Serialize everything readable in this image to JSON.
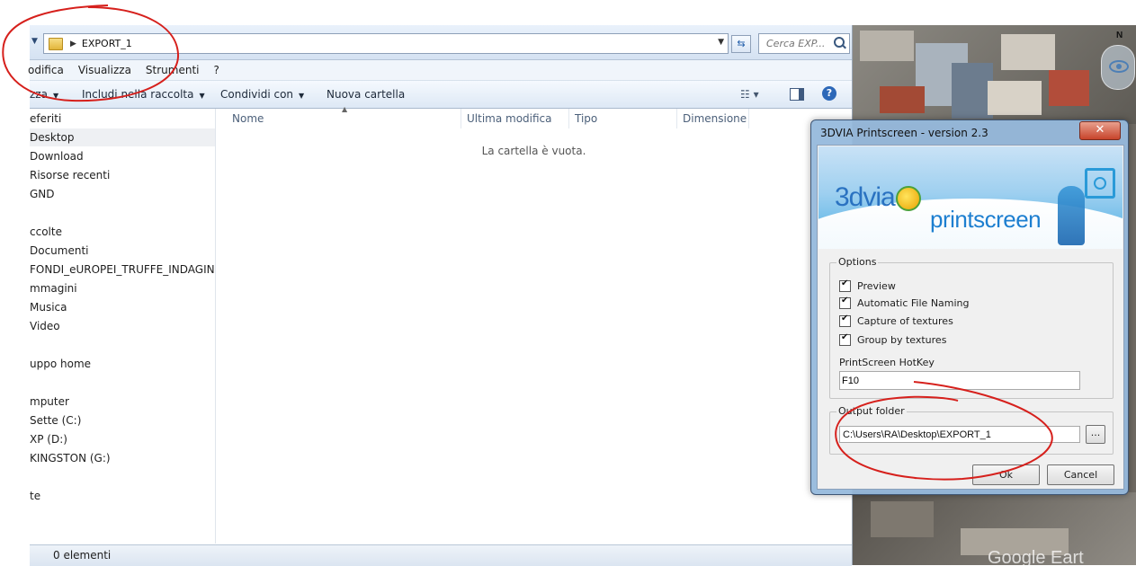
{
  "explorer": {
    "address": {
      "path": "EXPORT_1"
    },
    "search": {
      "placeholder": "Cerca EXP..."
    },
    "menu": [
      "odifica",
      "Visualizza",
      "Strumenti",
      "?"
    ],
    "commands": {
      "organize": "zza",
      "include": "Includi nella raccolta",
      "share": "Condividi con",
      "new_folder": "Nuova cartella"
    },
    "nav_items": [
      {
        "label": "eferiti",
        "selected": false
      },
      {
        "label": "Desktop",
        "selected": true
      },
      {
        "label": "Download",
        "selected": false
      },
      {
        "label": "Risorse recenti",
        "selected": false
      },
      {
        "label": "GND",
        "selected": false
      },
      {
        "label": "ccolte",
        "selected": false
      },
      {
        "label": "Documenti",
        "selected": false
      },
      {
        "label": "FONDI_eUROPEI_TRUFFE_INDAGINI_PER",
        "selected": false
      },
      {
        "label": "mmagini",
        "selected": false
      },
      {
        "label": "Musica",
        "selected": false
      },
      {
        "label": "Video",
        "selected": false
      },
      {
        "label": "uppo home",
        "selected": false
      },
      {
        "label": "mputer",
        "selected": false
      },
      {
        "label": "Sette (C:)",
        "selected": false
      },
      {
        "label": "XP (D:)",
        "selected": false
      },
      {
        "label": "KINGSTON (G:)",
        "selected": false
      },
      {
        "label": "te",
        "selected": false
      }
    ],
    "columns": [
      "Nome",
      "Ultima modifica",
      "Tipo",
      "Dimensione"
    ],
    "empty_message": "La cartella è vuota.",
    "status": "0 elementi"
  },
  "map": {
    "compass": "N",
    "watermark": "Google Eart"
  },
  "dialog": {
    "title": "3DVIA Printscreen - version 2.3",
    "close_label": "✕",
    "banner": {
      "brand": "3dvia",
      "product": "printscreen"
    },
    "options_title": "Options",
    "options": [
      {
        "label": "Preview",
        "checked": true
      },
      {
        "label": "Automatic File Naming",
        "checked": true
      },
      {
        "label": "Capture of textures",
        "checked": true
      },
      {
        "label": "Group by textures",
        "checked": true
      }
    ],
    "hotkey_label": "PrintScreen HotKey",
    "hotkey_value": "F10",
    "output_title": "Output folder",
    "output_path": "C:\\Users\\RA\\Desktop\\EXPORT_1",
    "browse_label": "...",
    "ok_label": "Ok",
    "cancel_label": "Cancel"
  },
  "colors": {
    "annotation": "#d6201c",
    "dialog_frame": "#96b9dc",
    "close_button": "#c7442b"
  }
}
